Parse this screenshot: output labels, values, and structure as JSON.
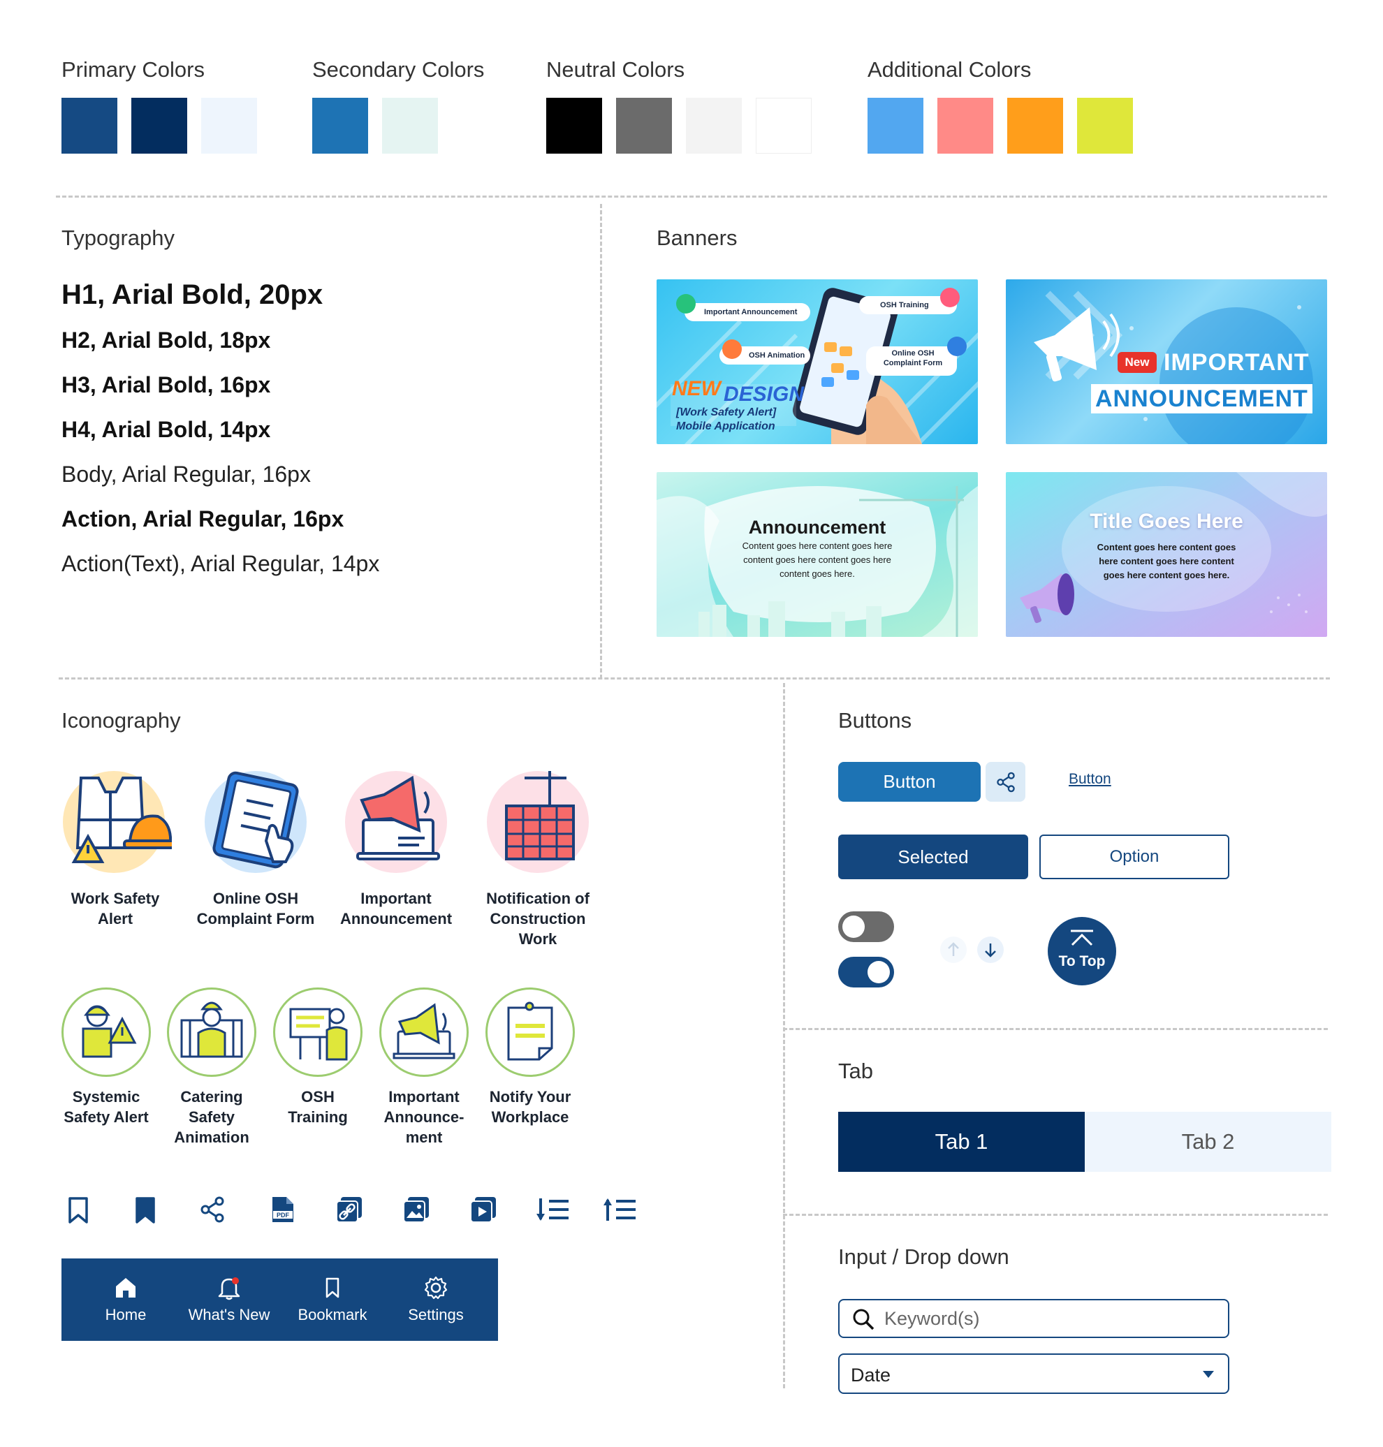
{
  "colors": {
    "primary_title": "Primary Colors",
    "primary": [
      "#154a83",
      "#032d5f",
      "#eef5fd"
    ],
    "secondary_title": "Secondary Colors",
    "secondary": [
      "#1e73b4",
      "#e5f4f2"
    ],
    "neutral_title": "Neutral Colors",
    "neutral": [
      "#000000",
      "#6b6b6b",
      "#f3f3f3",
      "#ffffff"
    ],
    "additional_title": "Additional Colors",
    "additional": [
      "#52a7f0",
      "#ff8a87",
      "#ff9e1b",
      "#dfe73a"
    ]
  },
  "typography": {
    "title": "Typography",
    "h1": "H1, Arial Bold, 20px",
    "h2": "H2, Arial Bold, 18px",
    "h3": "H3, Arial Bold, 16px",
    "h4": "H4, Arial Bold, 14px",
    "body": "Body, Arial Regular, 16px",
    "action": "Action, Arial Regular, 16px",
    "action_text": "Action(Text), Arial Regular, 14px"
  },
  "banners": {
    "title": "Banners",
    "b1": {
      "important_announcement": "Important Announcement",
      "osh_training": "OSH Training",
      "osh_animation": "OSH Animation",
      "online_osh_line1": "Online OSH",
      "online_osh_line2": "Complaint Form",
      "new_design_1": "NEW",
      "new_design_2": "DESIGN",
      "sub1": "[Work Safety Alert]",
      "sub2": "Mobile Application"
    },
    "b2": {
      "badge": "New",
      "line1": "IMPORTANT",
      "line2": "ANNOUNCEMENT"
    },
    "b3": {
      "title": "Announcement",
      "body1": "Content goes here content goes here",
      "body2": "content goes here content goes here",
      "body3": "content goes here."
    },
    "b4": {
      "title": "Title Goes Here",
      "body1": "Content goes here content goes",
      "body2": "here content goes here content",
      "body3": "goes here content goes here."
    }
  },
  "iconography": {
    "title": "Iconography",
    "row1": [
      {
        "l1": "Work Safety",
        "l2": "Alert",
        "l3": ""
      },
      {
        "l1": "Online OSH",
        "l2": "Complaint Form",
        "l3": ""
      },
      {
        "l1": "Important",
        "l2": "Announcement",
        "l3": ""
      },
      {
        "l1": "Notification of",
        "l2": "Construction",
        "l3": "Work"
      }
    ],
    "row2": [
      {
        "l1": "Systemic",
        "l2": "Safety Alert",
        "l3": ""
      },
      {
        "l1": "Catering",
        "l2": "Safety",
        "l3": "Animation"
      },
      {
        "l1": "OSH",
        "l2": "Training",
        "l3": ""
      },
      {
        "l1": "Important",
        "l2": "Announce-",
        "l3": "ment"
      },
      {
        "l1": "Notify Your",
        "l2": "Workplace",
        "l3": ""
      }
    ]
  },
  "bottom_nav": {
    "home": "Home",
    "whats_new": "What's New",
    "bookmark": "Bookmark",
    "settings": "Settings"
  },
  "buttons": {
    "title": "Buttons",
    "primary": "Button",
    "text_link": "Button",
    "selected": "Selected",
    "option": "Option",
    "to_top": "To Top"
  },
  "tab": {
    "title": "Tab",
    "tab1": "Tab 1",
    "tab2": "Tab 2"
  },
  "input": {
    "title": "Input / Drop down",
    "placeholder": "Keyword(s)",
    "select_value": "Date"
  }
}
